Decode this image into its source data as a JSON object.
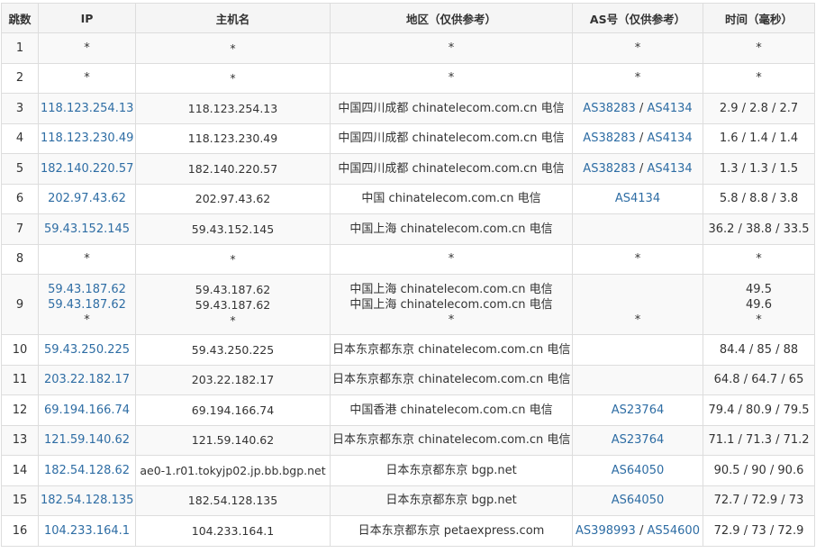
{
  "headers": {
    "hop": "跳数",
    "ip": "IP",
    "host": "主机名",
    "location": "地区（仅供参考）",
    "asn": "AS号（仅供参考）",
    "time": "时间（毫秒）"
  },
  "rows": [
    {
      "hop": "1",
      "ip": [
        "*"
      ],
      "host": [
        "*"
      ],
      "location": [
        "*"
      ],
      "asn": [
        [
          "*"
        ]
      ],
      "time": [
        "*"
      ]
    },
    {
      "hop": "2",
      "ip": [
        "*"
      ],
      "host": [
        "*"
      ],
      "location": [
        "*"
      ],
      "asn": [
        [
          "*"
        ]
      ],
      "time": [
        "*"
      ]
    },
    {
      "hop": "3",
      "ip": [
        "118.123.254.13"
      ],
      "host": [
        "118.123.254.13"
      ],
      "location": [
        "中国四川成都 chinatelecom.com.cn 电信"
      ],
      "asn": [
        [
          "AS38283",
          "AS4134"
        ]
      ],
      "time": [
        "2.9 / 2.8 / 2.7"
      ]
    },
    {
      "hop": "4",
      "ip": [
        "118.123.230.49"
      ],
      "host": [
        "118.123.230.49"
      ],
      "location": [
        "中国四川成都 chinatelecom.com.cn 电信"
      ],
      "asn": [
        [
          "AS38283",
          "AS4134"
        ]
      ],
      "time": [
        "1.6 / 1.4 / 1.4"
      ]
    },
    {
      "hop": "5",
      "ip": [
        "182.140.220.57"
      ],
      "host": [
        "182.140.220.57"
      ],
      "location": [
        "中国四川成都 chinatelecom.com.cn 电信"
      ],
      "asn": [
        [
          "AS38283",
          "AS4134"
        ]
      ],
      "time": [
        "1.3 / 1.3 / 1.5"
      ]
    },
    {
      "hop": "6",
      "ip": [
        "202.97.43.62"
      ],
      "host": [
        "202.97.43.62"
      ],
      "location": [
        "中国 chinatelecom.com.cn 电信"
      ],
      "asn": [
        [
          "AS4134"
        ]
      ],
      "time": [
        "5.8 / 8.8 / 3.8"
      ]
    },
    {
      "hop": "7",
      "ip": [
        "59.43.152.145"
      ],
      "host": [
        "59.43.152.145"
      ],
      "location": [
        "中国上海 chinatelecom.com.cn 电信"
      ],
      "asn": [
        []
      ],
      "time": [
        "36.2 / 38.8 / 33.5"
      ]
    },
    {
      "hop": "8",
      "ip": [
        "*"
      ],
      "host": [
        "*"
      ],
      "location": [
        "*"
      ],
      "asn": [
        [
          "*"
        ]
      ],
      "time": [
        "*"
      ]
    },
    {
      "hop": "9",
      "ip": [
        "59.43.187.62",
        "59.43.187.62",
        "*"
      ],
      "host": [
        "59.43.187.62",
        "59.43.187.62",
        "*"
      ],
      "location": [
        "中国上海 chinatelecom.com.cn 电信",
        "中国上海 chinatelecom.com.cn 电信",
        "*"
      ],
      "asn": [
        [],
        [],
        [
          "*"
        ]
      ],
      "time": [
        "49.5",
        "49.6",
        "*"
      ]
    },
    {
      "hop": "10",
      "ip": [
        "59.43.250.225"
      ],
      "host": [
        "59.43.250.225"
      ],
      "location": [
        "日本东京都东京 chinatelecom.com.cn 电信"
      ],
      "asn": [
        []
      ],
      "time": [
        "84.4 / 85 / 88"
      ]
    },
    {
      "hop": "11",
      "ip": [
        "203.22.182.17"
      ],
      "host": [
        "203.22.182.17"
      ],
      "location": [
        "日本东京都东京 chinatelecom.com.cn 电信"
      ],
      "asn": [
        []
      ],
      "time": [
        "64.8 / 64.7 / 65"
      ]
    },
    {
      "hop": "12",
      "ip": [
        "69.194.166.74"
      ],
      "host": [
        "69.194.166.74"
      ],
      "location": [
        "中国香港 chinatelecom.com.cn 电信"
      ],
      "asn": [
        [
          "AS23764"
        ]
      ],
      "time": [
        "79.4 / 80.9 / 79.5"
      ]
    },
    {
      "hop": "13",
      "ip": [
        "121.59.140.62"
      ],
      "host": [
        "121.59.140.62"
      ],
      "location": [
        "日本东京都东京 chinatelecom.com.cn 电信"
      ],
      "asn": [
        [
          "AS23764"
        ]
      ],
      "time": [
        "71.1 / 71.3 / 71.2"
      ]
    },
    {
      "hop": "14",
      "ip": [
        "182.54.128.62"
      ],
      "host": [
        "ae0-1.r01.tokyjp02.jp.bb.bgp.net"
      ],
      "location": [
        "日本东京都东京 bgp.net"
      ],
      "asn": [
        [
          "AS64050"
        ]
      ],
      "time": [
        "90.5 / 90 / 90.6"
      ]
    },
    {
      "hop": "15",
      "ip": [
        "182.54.128.135"
      ],
      "host": [
        "182.54.128.135"
      ],
      "location": [
        "日本东京都东京 bgp.net"
      ],
      "asn": [
        [
          "AS64050"
        ]
      ],
      "time": [
        "72.7 / 72.9 / 73"
      ]
    },
    {
      "hop": "16",
      "ip": [
        "104.233.164.1"
      ],
      "host": [
        "104.233.164.1"
      ],
      "location": [
        "日本东京都东京 petaexpress.com"
      ],
      "asn": [
        [
          "AS398993",
          "AS54600"
        ]
      ],
      "time": [
        "72.9 / 73 / 72.9"
      ]
    }
  ],
  "colors": {
    "link": "#2e6da4",
    "header_bg": "#f5f5f5",
    "stripe_bg": "#f9f9f9",
    "border": "#dddddd",
    "text": "#333333"
  }
}
